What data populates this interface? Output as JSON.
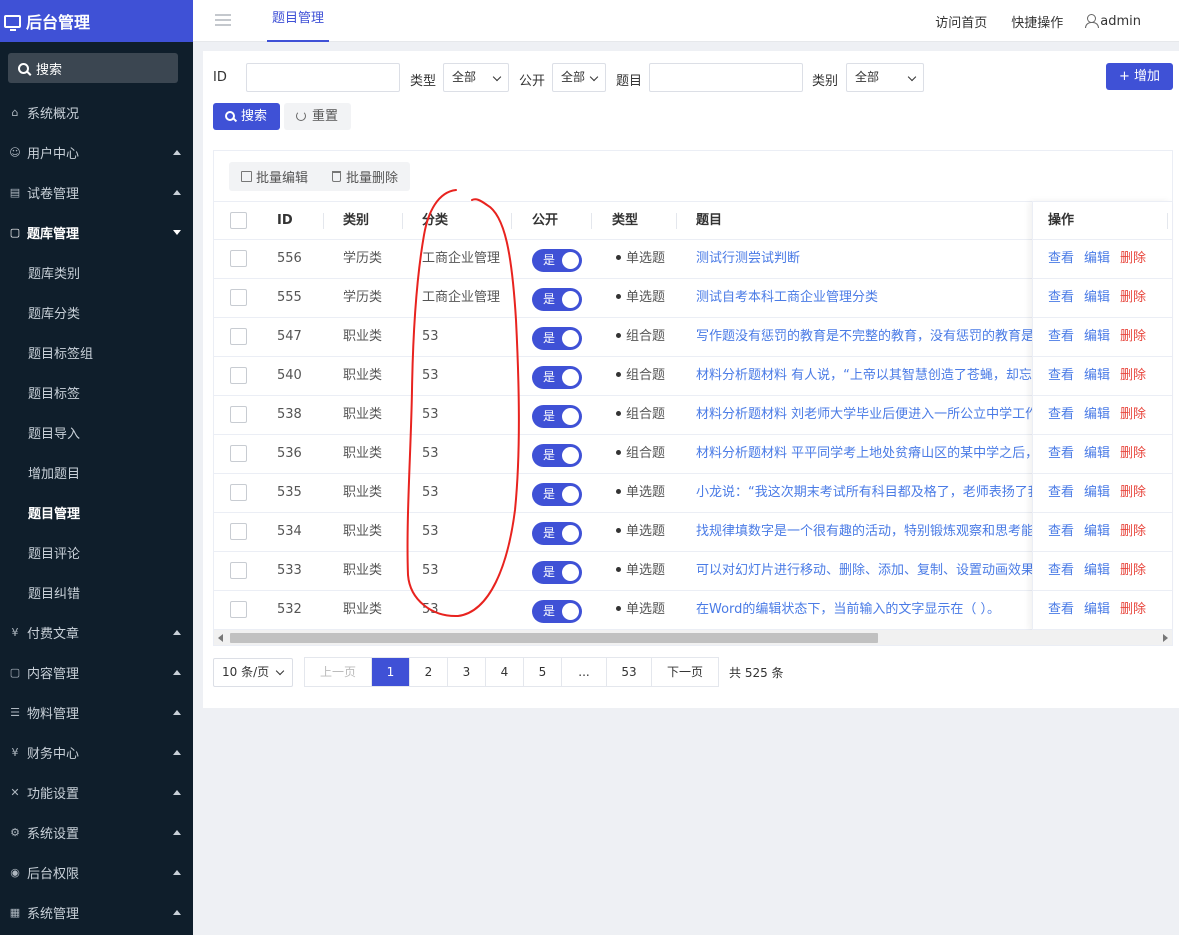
{
  "brand": {
    "title": "后台管理"
  },
  "sidebar": {
    "search_label": "搜索",
    "items": [
      {
        "label": "系统概况",
        "icon": "home-icon",
        "caret": false
      },
      {
        "label": "用户中心",
        "icon": "users-icon",
        "caret": true
      },
      {
        "label": "试卷管理",
        "icon": "paper-icon",
        "caret": true
      },
      {
        "label": "题库管理",
        "icon": "document-icon",
        "caret": true,
        "open": true
      }
    ],
    "subitems": [
      "题库类别",
      "题库分类",
      "题目标签组",
      "题目标签",
      "题目导入",
      "增加题目",
      "题目管理",
      "题目评论",
      "题目纠错"
    ],
    "current_sub": "题目管理",
    "items_after": [
      {
        "label": "付费文章",
        "icon": "yen-icon"
      },
      {
        "label": "内容管理",
        "icon": "document-icon"
      },
      {
        "label": "物料管理",
        "icon": "list-icon"
      },
      {
        "label": "财务中心",
        "icon": "yen-icon"
      },
      {
        "label": "功能设置",
        "icon": "tools-icon"
      },
      {
        "label": "系统设置",
        "icon": "gear-icon"
      },
      {
        "label": "后台权限",
        "icon": "user-circle-icon"
      },
      {
        "label": "系统管理",
        "icon": "chart-icon"
      }
    ]
  },
  "topbar": {
    "tab": "题目管理",
    "visit_home": "访问首页",
    "quick_ops": "快捷操作",
    "user": "admin"
  },
  "filters": {
    "id_label": "ID",
    "type_label": "类型",
    "type_value": "全部",
    "public_label": "公开",
    "public_value": "全部",
    "question_label": "题目",
    "category_label": "类别",
    "category_value": "全部",
    "add_label": "+ 增加",
    "search_label": "搜索",
    "reset_label": "重置"
  },
  "batch": {
    "edit": "批量编辑",
    "delete": "批量删除"
  },
  "table": {
    "headers": {
      "id": "ID",
      "category": "类别",
      "classify": "分类",
      "public": "公开",
      "type": "类型",
      "question": "题目",
      "ops": "操作"
    },
    "switch_label": "是",
    "ops": {
      "view": "查看",
      "edit": "编辑",
      "delete": "删除"
    },
    "rows": [
      {
        "id": "556",
        "category": "学历类",
        "classify": "工商企业管理",
        "type": "单选题",
        "question": "测试行测尝试判断"
      },
      {
        "id": "555",
        "category": "学历类",
        "classify": "工商企业管理",
        "type": "单选题",
        "question": "测试自考本科工商企业管理分类"
      },
      {
        "id": "547",
        "category": "职业类",
        "classify": "53",
        "type": "组合题",
        "question": "写作题没有惩罚的教育是不完整的教育，没有惩罚的教育是"
      },
      {
        "id": "540",
        "category": "职业类",
        "classify": "53",
        "type": "组合题",
        "question": "材料分析题材料 有人说，“上帝以其智慧创造了苍蝇，却忘"
      },
      {
        "id": "538",
        "category": "职业类",
        "classify": "53",
        "type": "组合题",
        "question": "材料分析题材料 刘老师大学毕业后便进入一所公立中学工作"
      },
      {
        "id": "536",
        "category": "职业类",
        "classify": "53",
        "type": "组合题",
        "question": "材料分析题材料 平平同学考上地处贫瘠山区的某中学之后，"
      },
      {
        "id": "535",
        "category": "职业类",
        "classify": "53",
        "type": "单选题",
        "question": "小龙说：“我这次期末考试所有科目都及格了，老师表扬了我"
      },
      {
        "id": "534",
        "category": "职业类",
        "classify": "53",
        "type": "单选题",
        "question": "找规律填数字是一个很有趣的活动，特别锻炼观察和思考能力"
      },
      {
        "id": "533",
        "category": "职业类",
        "classify": "53",
        "type": "单选题",
        "question": "可以对幻灯片进行移动、删除、添加、复制、设置动画效果"
      },
      {
        "id": "532",
        "category": "职业类",
        "classify": "53",
        "type": "单选题",
        "question": "在Word的编辑状态下，当前输入的文字显示在（ ）。"
      }
    ]
  },
  "pager": {
    "size": "10 条/页",
    "prev": "上一页",
    "pages": [
      "1",
      "2",
      "3",
      "4",
      "5",
      "...",
      "53"
    ],
    "current": "1",
    "next": "下一页",
    "total": "共 525 条"
  },
  "colors": {
    "accent": "#3f51d6",
    "sidebar": "#0f1e2b",
    "link": "#4a7be6",
    "danger": "#e8453c",
    "annotation": "#e8231f"
  }
}
